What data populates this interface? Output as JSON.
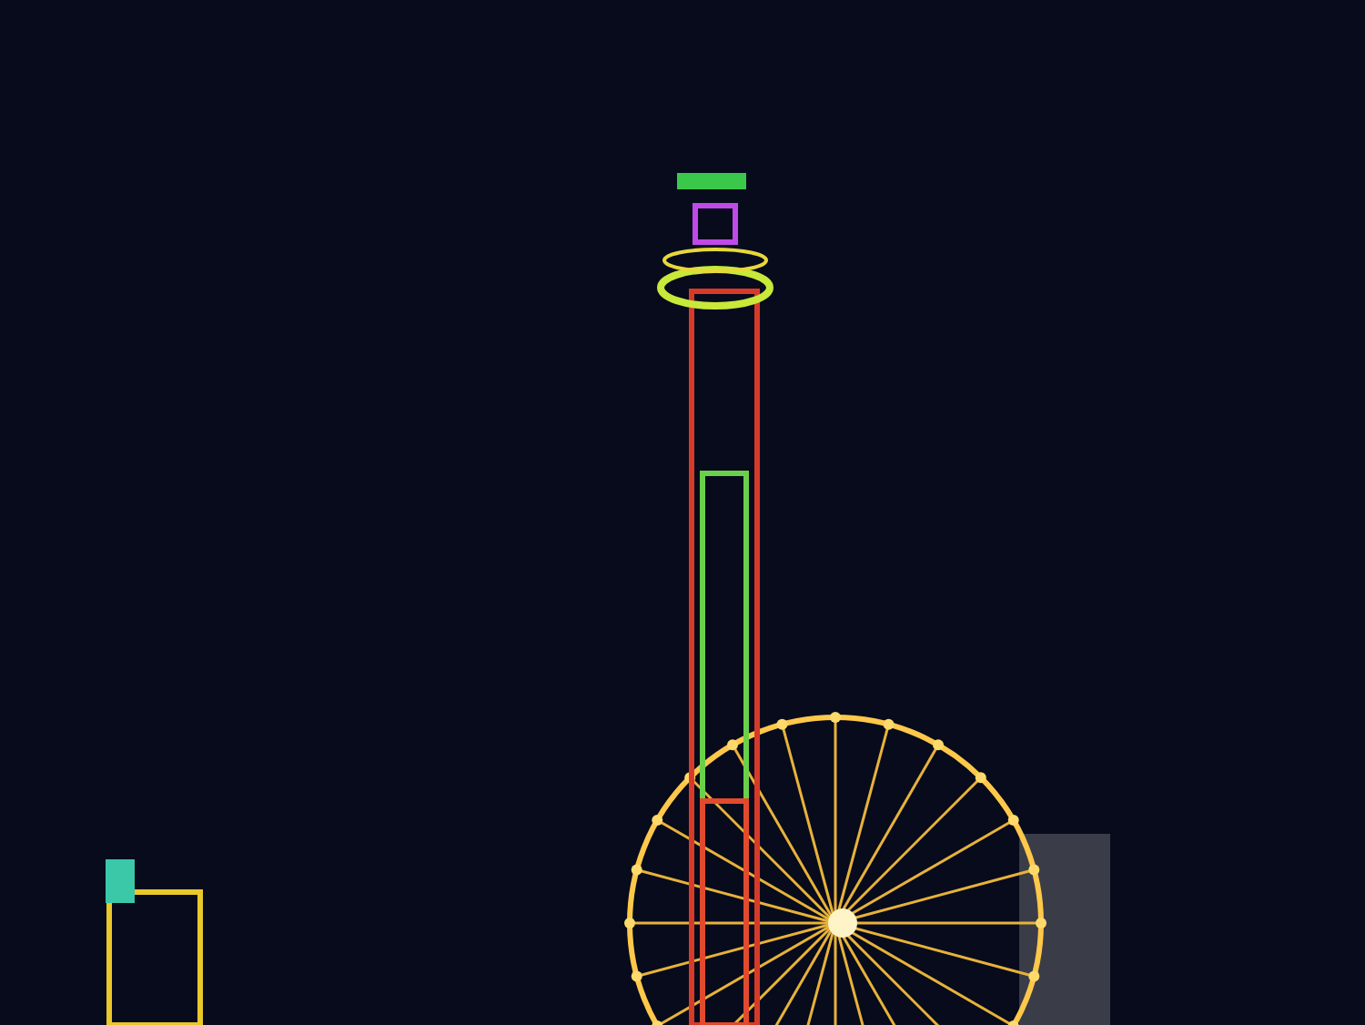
{
  "photo": {
    "kind": "fairground-night"
  }
}
